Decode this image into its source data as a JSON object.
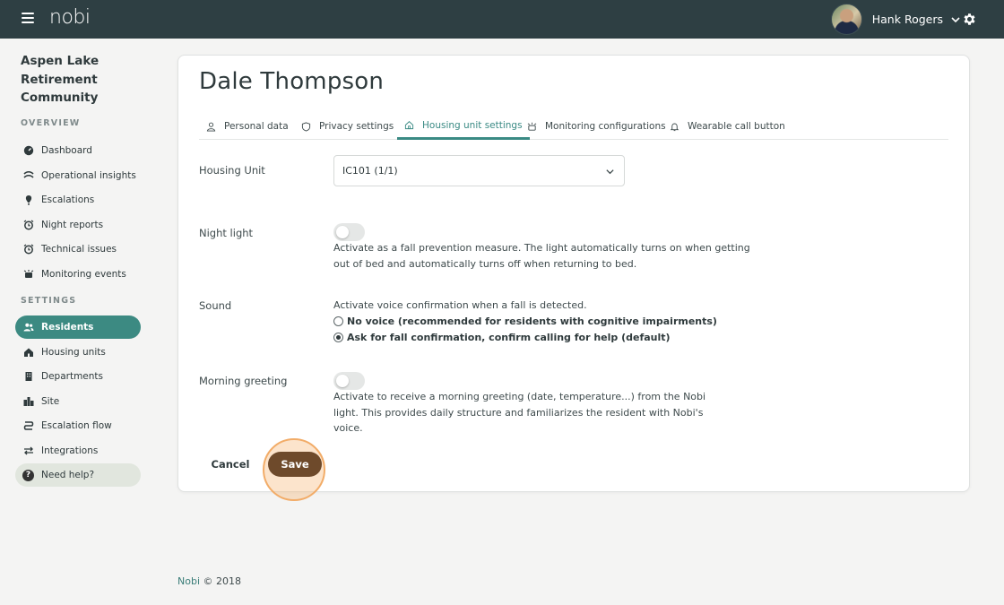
{
  "topbar": {
    "logo": "nobi",
    "user_name": "Hank Rogers"
  },
  "sidebar": {
    "org_name": "Aspen Lake Retirement Community",
    "overview_label": "OVERVIEW",
    "overview_items": [
      {
        "label": "Dashboard",
        "icon": "dashboard-icon"
      },
      {
        "label": "Operational insights",
        "icon": "insights-icon"
      },
      {
        "label": "Escalations",
        "icon": "escalation-icon"
      },
      {
        "label": "Night reports",
        "icon": "alarm-clock-icon"
      },
      {
        "label": "Technical issues",
        "icon": "alarm-clock-icon"
      },
      {
        "label": "Monitoring events",
        "icon": "monitoring-icon"
      }
    ],
    "settings_label": "SETTINGS",
    "settings_items": [
      {
        "label": "Residents",
        "icon": "users-icon",
        "active": true
      },
      {
        "label": "Housing units",
        "icon": "house-icon"
      },
      {
        "label": "Departments",
        "icon": "building-icon"
      },
      {
        "label": "Site",
        "icon": "city-icon"
      },
      {
        "label": "Escalation flow",
        "icon": "flow-icon"
      },
      {
        "label": "Integrations",
        "icon": "arrows-icon"
      }
    ],
    "help_label": "Need help?"
  },
  "main": {
    "resident_name": "Dale Thompson",
    "tabs": [
      {
        "label": "Personal data",
        "icon": "person-icon"
      },
      {
        "label": "Privacy settings",
        "icon": "shield-icon"
      },
      {
        "label": "Housing unit settings",
        "icon": "house-icon",
        "active": true
      },
      {
        "label": "Monitoring configurations",
        "icon": "monitoring-icon"
      },
      {
        "label": "Wearable call button",
        "icon": "bell-icon"
      }
    ],
    "housing_unit": {
      "label": "Housing Unit",
      "value": "IC101 (1/1)"
    },
    "night_light": {
      "label": "Night light",
      "enabled": false,
      "description": "Activate as a fall prevention measure. The light automatically turns on when getting out of bed and automatically turns off when returning to bed."
    },
    "sound": {
      "label": "Sound",
      "description": "Activate voice confirmation when a fall is detected.",
      "options": [
        {
          "label": "No voice (recommended for residents with cognitive impairments)",
          "checked": false
        },
        {
          "label": "Ask for fall confirmation, confirm calling for help (default)",
          "checked": true
        }
      ]
    },
    "morning_greeting": {
      "label": "Morning greeting",
      "enabled": false,
      "description": "Activate to receive a morning greeting (date, temperature...) from the Nobi light. This provides daily structure and familiarizes the resident with Nobi's voice."
    },
    "cancel_label": "Cancel",
    "save_label": "Save"
  },
  "footer": {
    "brand": "Nobi",
    "copyright": "© 2018"
  },
  "colors": {
    "topbar": "#2e3f43",
    "accent": "#3c8a82",
    "save": "#6e4a2b",
    "highlight": "#f2ac68"
  }
}
